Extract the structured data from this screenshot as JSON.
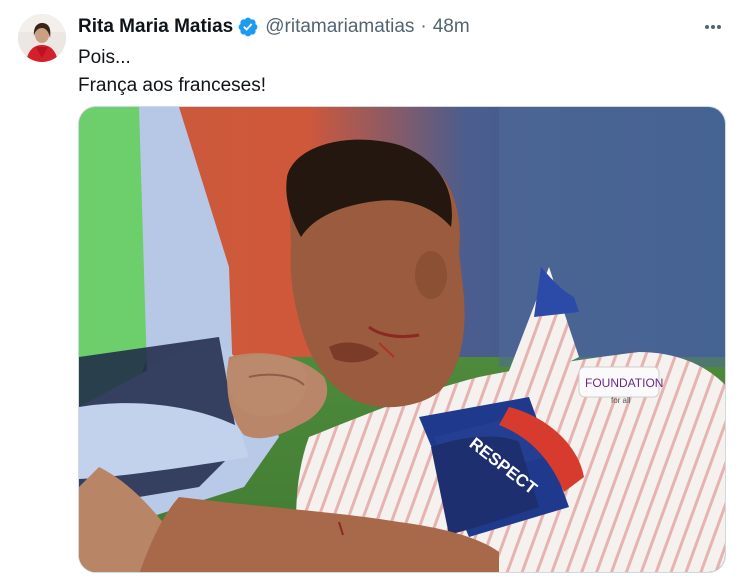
{
  "tweet": {
    "display_name": "Rita Maria Matias",
    "handle": "@ritamariamatias",
    "separator": "·",
    "time": "48m",
    "text_lines": [
      "Pois...",
      "França aos franceses!"
    ]
  },
  "icons": {
    "verified": "verified-badge-icon",
    "more": "more-options-icon"
  },
  "media": {
    "armband_text": "RESPECT",
    "patch_text": "FOUNDATION",
    "patch_sub": "for all"
  },
  "colors": {
    "text_primary": "#0f1419",
    "text_secondary": "#536471",
    "verified_blue": "#1d9bf0",
    "media_border": "#cfd9de"
  }
}
